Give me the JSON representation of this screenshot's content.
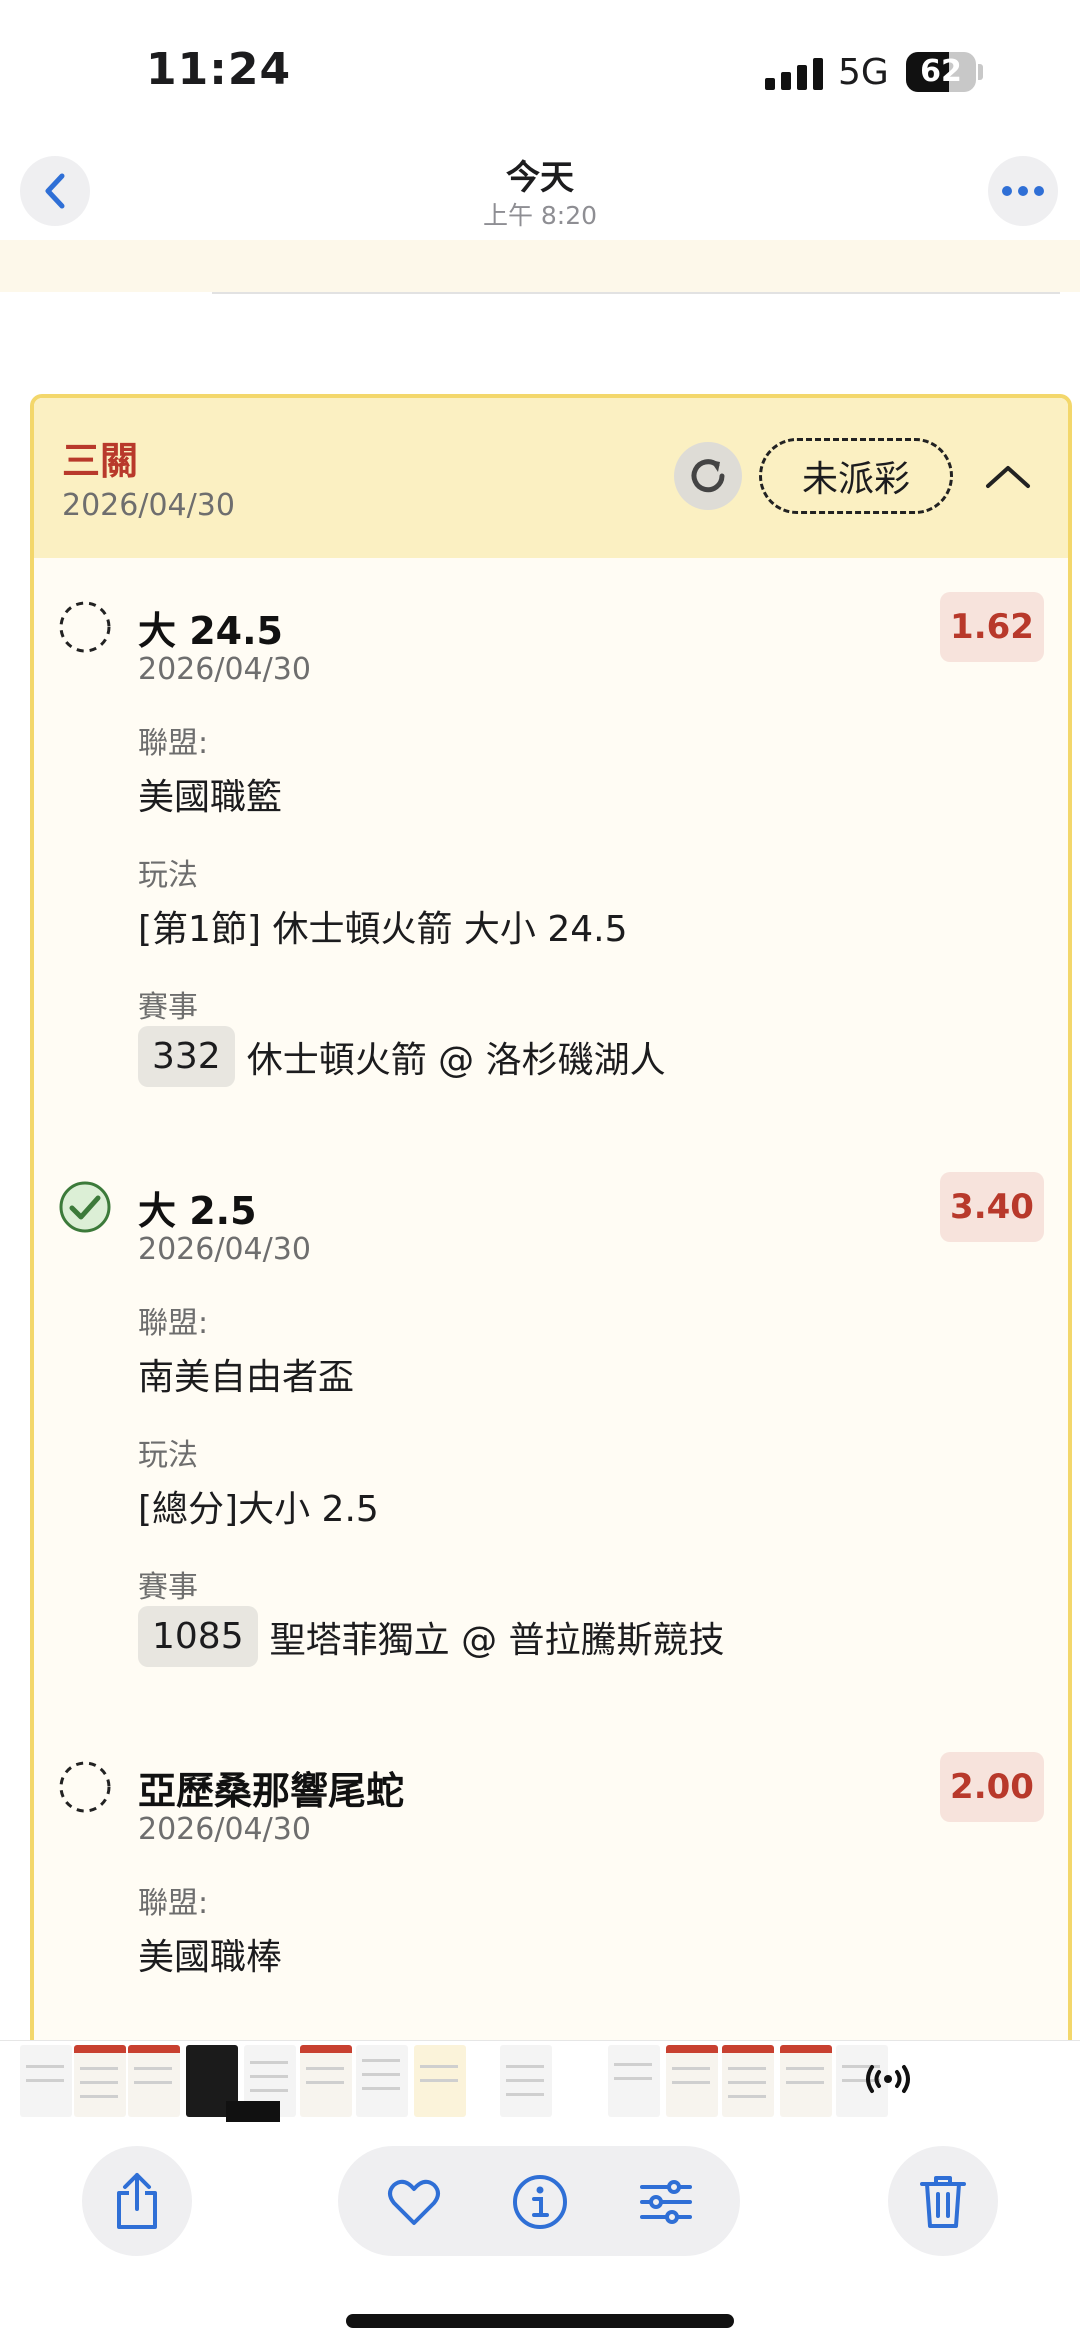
{
  "status_bar": {
    "time": "11:24",
    "network": "5G",
    "battery": "62",
    "battery_level": 0.62
  },
  "nav": {
    "title": "今天",
    "subtitle": "上午 8:20"
  },
  "ticket": {
    "title": "三關",
    "date": "2026/04/30",
    "status": "未派彩",
    "legs": [
      {
        "state": "pending",
        "name": "大 24.5",
        "date": "2026/04/30",
        "odds": "1.62",
        "league_label": "聯盟:",
        "league": "美國職籃",
        "play_label": "玩法",
        "play": "[第1節] 休士頓火箭 大小 24.5",
        "event_label": "賽事",
        "event_id": "332",
        "event_name": "休士頓火箭 @ 洛杉磯湖人"
      },
      {
        "state": "won",
        "name": "大 2.5",
        "date": "2026/04/30",
        "odds": "3.40",
        "league_label": "聯盟:",
        "league": "南美自由者盃",
        "play_label": "玩法",
        "play": "[總分]大小 2.5",
        "event_label": "賽事",
        "event_id": "1085",
        "event_name": "聖塔菲獨立 @ 普拉騰斯競技"
      },
      {
        "state": "pending",
        "name": "亞歷桑那響尾蛇",
        "date": "2026/04/30",
        "odds": "2.00",
        "league_label": "聯盟:",
        "league": "美國職棒"
      }
    ]
  },
  "icons": {
    "back": "chevron-left-icon",
    "more": "ellipsis-icon",
    "refresh": "refresh-icon",
    "collapse": "chevron-up-icon",
    "pending": "dashed-circle-icon",
    "won": "check-circle-icon",
    "live_text": "live-text-icon",
    "share": "share-icon",
    "favorite": "heart-icon",
    "info": "info-icon",
    "adjust": "sliders-icon",
    "delete": "trash-icon",
    "airplay": "airplay-icon"
  },
  "colors": {
    "accent": "#2f6fd6",
    "title_red": "#b8392b",
    "border_yellow": "#f3d76b",
    "header_yellow": "#fbf0c2",
    "odds_bg": "#f7e3dc",
    "check_green": "#3c7a3a"
  }
}
